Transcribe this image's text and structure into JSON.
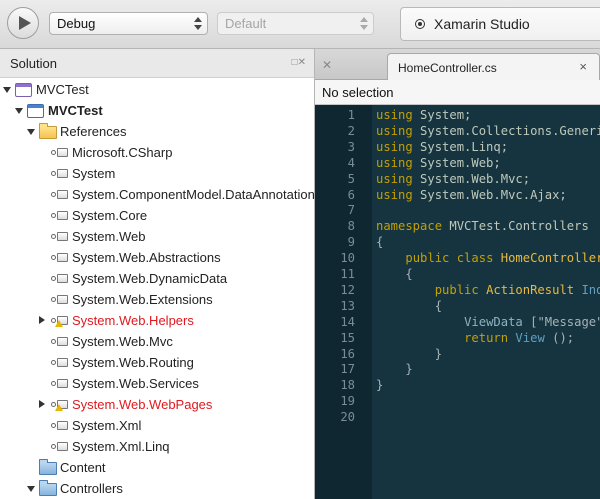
{
  "toolbar": {
    "configuration": "Debug",
    "target": "Default",
    "status_text": "Xamarin Studio"
  },
  "solution_pad": {
    "title": "Solution",
    "tree": [
      {
        "label": "MVCTest",
        "icon": "solution-icon",
        "expander": "down",
        "state": "normal"
      },
      {
        "label": "MVCTest",
        "icon": "project-icon",
        "expander": "down",
        "state": "bold"
      },
      {
        "label": "References",
        "icon": "folder-icon",
        "expander": "down",
        "state": "normal"
      },
      {
        "label": "Microsoft.CSharp",
        "icon": "reference-icon",
        "expander": "none",
        "state": "normal"
      },
      {
        "label": "System",
        "icon": "reference-icon",
        "expander": "none",
        "state": "normal"
      },
      {
        "label": "System.ComponentModel.DataAnnotations",
        "icon": "reference-icon",
        "expander": "none",
        "state": "normal"
      },
      {
        "label": "System.Core",
        "icon": "reference-icon",
        "expander": "none",
        "state": "normal"
      },
      {
        "label": "System.Web",
        "icon": "reference-icon",
        "expander": "none",
        "state": "normal"
      },
      {
        "label": "System.Web.Abstractions",
        "icon": "reference-icon",
        "expander": "none",
        "state": "normal"
      },
      {
        "label": "System.Web.DynamicData",
        "icon": "reference-icon",
        "expander": "none",
        "state": "normal"
      },
      {
        "label": "System.Web.Extensions",
        "icon": "reference-icon",
        "expander": "none",
        "state": "normal"
      },
      {
        "label": "System.Web.Helpers",
        "icon": "warning-reference-icon",
        "expander": "right",
        "state": "error"
      },
      {
        "label": "System.Web.Mvc",
        "icon": "reference-icon",
        "expander": "none",
        "state": "normal"
      },
      {
        "label": "System.Web.Routing",
        "icon": "reference-icon",
        "expander": "none",
        "state": "normal"
      },
      {
        "label": "System.Web.Services",
        "icon": "reference-icon",
        "expander": "none",
        "state": "normal"
      },
      {
        "label": "System.Web.WebPages",
        "icon": "warning-reference-icon",
        "expander": "right",
        "state": "error"
      },
      {
        "label": "System.Xml",
        "icon": "reference-icon",
        "expander": "none",
        "state": "normal"
      },
      {
        "label": "System.Xml.Linq",
        "icon": "reference-icon",
        "expander": "none",
        "state": "normal"
      },
      {
        "label": "Content",
        "icon": "blue-folder-icon",
        "expander": "none",
        "state": "normal"
      },
      {
        "label": "Controllers",
        "icon": "blue-folder-icon",
        "expander": "down",
        "state": "normal"
      }
    ]
  },
  "editor": {
    "tab_label": "HomeController.cs",
    "tab_close": "×",
    "selection_status": "No selection",
    "line_numbers": [
      "1",
      "2",
      "3",
      "4",
      "5",
      "6",
      "7",
      "8",
      "9",
      "10",
      "11",
      "12",
      "13",
      "14",
      "15",
      "16",
      "17",
      "18",
      "19",
      "20"
    ],
    "lines": [
      [
        {
          "t": "using",
          "c": "kw"
        },
        {
          "t": " System;",
          "c": "ty"
        }
      ],
      [
        {
          "t": "using",
          "c": "kw"
        },
        {
          "t": " System.Collections.Generic;",
          "c": "ty"
        }
      ],
      [
        {
          "t": "using",
          "c": "kw"
        },
        {
          "t": " System.Linq;",
          "c": "ty"
        }
      ],
      [
        {
          "t": "using",
          "c": "kw"
        },
        {
          "t": " System.Web;",
          "c": "ty"
        }
      ],
      [
        {
          "t": "using",
          "c": "kw"
        },
        {
          "t": " System.Web.Mvc;",
          "c": "ty"
        }
      ],
      [
        {
          "t": "using",
          "c": "kw"
        },
        {
          "t": " System.Web.Mvc.Ajax;",
          "c": "ty"
        }
      ],
      [],
      [
        {
          "t": "namespace",
          "c": "kw"
        },
        {
          "t": " MVCTest.Controllers",
          "c": "ty"
        }
      ],
      [
        {
          "t": "{",
          "c": "plain"
        }
      ],
      [
        {
          "t": "    ",
          "c": "plain"
        },
        {
          "t": "public class",
          "c": "kw"
        },
        {
          "t": " HomeController",
          "c": "tp"
        }
      ],
      [
        {
          "t": "    {",
          "c": "plain"
        }
      ],
      [
        {
          "t": "        ",
          "c": "plain"
        },
        {
          "t": "public",
          "c": "kw"
        },
        {
          "t": " ActionResult",
          "c": "tp"
        },
        {
          "t": " Index",
          "c": "mth"
        }
      ],
      [
        {
          "t": "        {",
          "c": "plain"
        }
      ],
      [
        {
          "t": "            ",
          "c": "plain"
        },
        {
          "t": "ViewData",
          "c": "ident"
        },
        {
          "t": " [\"Message\"]",
          "c": "plain"
        }
      ],
      [
        {
          "t": "            ",
          "c": "plain"
        },
        {
          "t": "return",
          "c": "kw"
        },
        {
          "t": " View",
          "c": "mth"
        },
        {
          "t": " ();",
          "c": "plain"
        }
      ],
      [
        {
          "t": "        }",
          "c": "plain"
        }
      ],
      [
        {
          "t": "    }",
          "c": "plain"
        }
      ],
      [
        {
          "t": "}",
          "c": "plain"
        }
      ],
      [],
      []
    ]
  }
}
